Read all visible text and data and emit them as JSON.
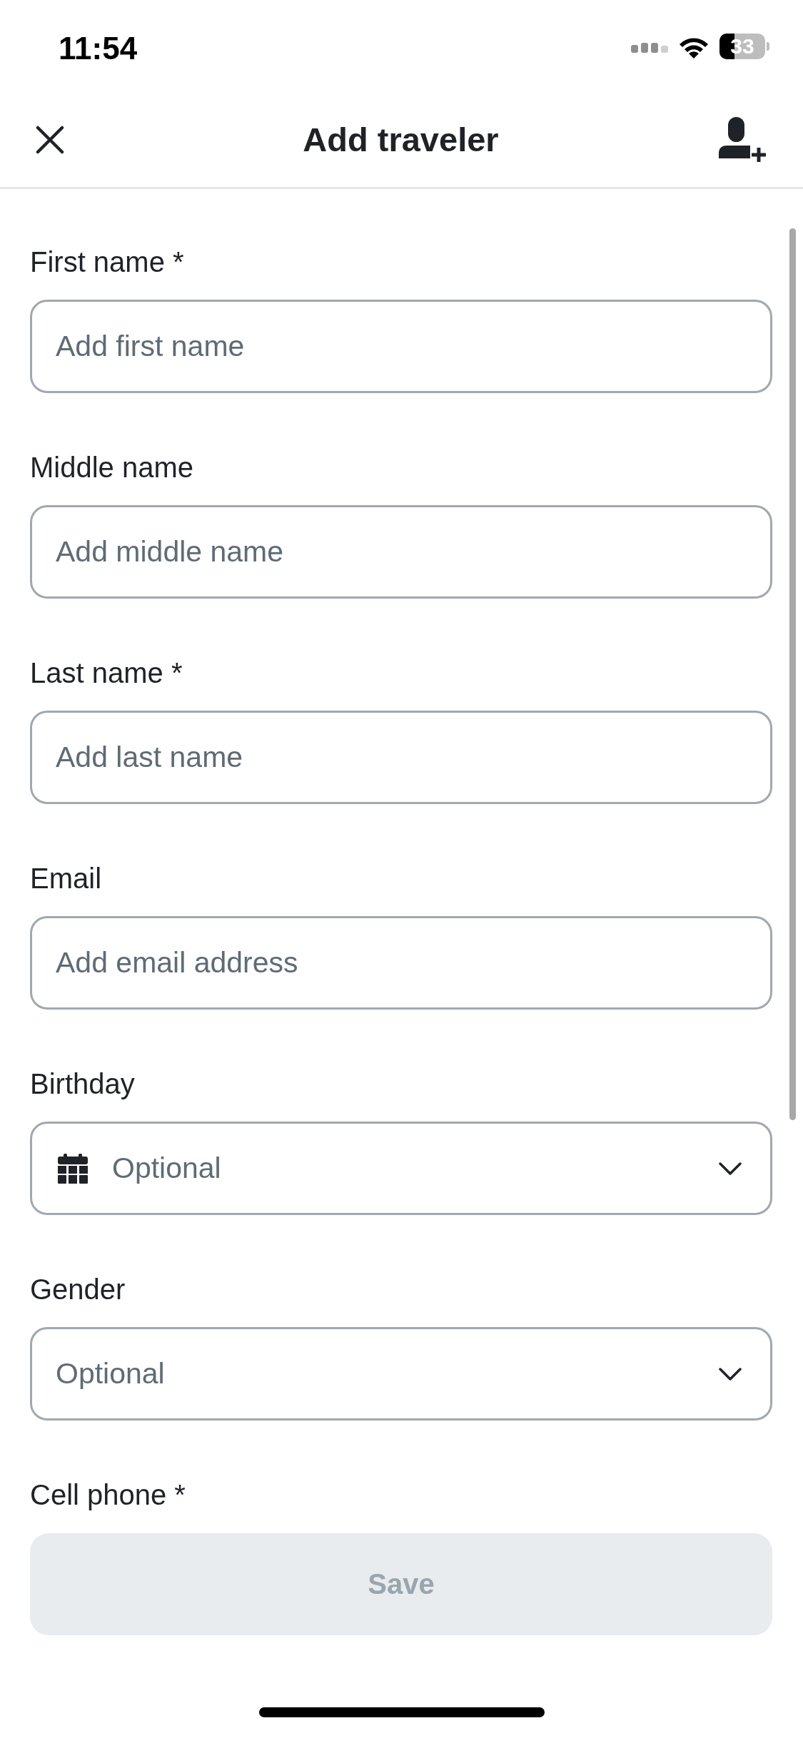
{
  "status_bar": {
    "time": "11:54",
    "battery": "33"
  },
  "header": {
    "title": "Add traveler"
  },
  "fields": [
    {
      "kind": "text",
      "label": "First name *",
      "placeholder": "Add first name"
    },
    {
      "kind": "text",
      "label": "Middle name",
      "placeholder": "Add middle name"
    },
    {
      "kind": "text",
      "label": "Last name *",
      "placeholder": "Add last name"
    },
    {
      "kind": "text",
      "label": "Email",
      "placeholder": "Add email address"
    },
    {
      "kind": "date",
      "label": "Birthday",
      "placeholder": "Optional"
    },
    {
      "kind": "select",
      "label": "Gender",
      "placeholder": "Optional"
    },
    {
      "kind": "label_only",
      "label": "Cell phone *"
    }
  ],
  "save_button": {
    "label": "Save",
    "disabled": true
  }
}
